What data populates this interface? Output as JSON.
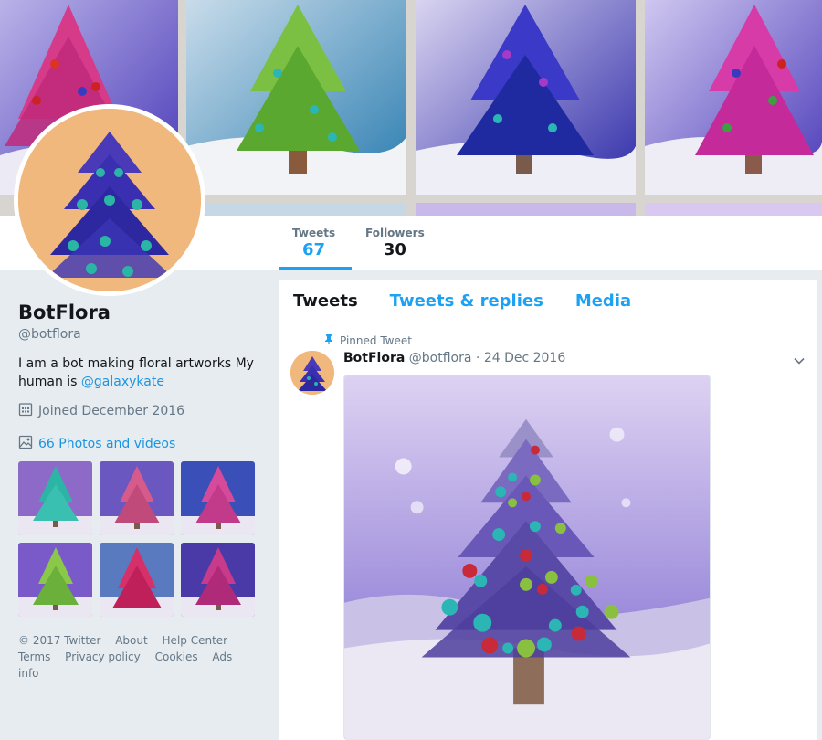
{
  "profile": {
    "name": "BotFlora",
    "handle": "@botflora",
    "bio_text": "I am a bot making floral artworks My human is ",
    "bio_link": "@galaxykate",
    "joined": "Joined December 2016",
    "photos_link": "66 Photos and videos"
  },
  "stats": [
    {
      "label": "Tweets",
      "value": "67"
    },
    {
      "label": "Followers",
      "value": "30"
    }
  ],
  "tabs": [
    "Tweets",
    "Tweets & replies",
    "Media"
  ],
  "tweet": {
    "pinned_label": "Pinned Tweet",
    "author": "BotFlora",
    "handle": "@botflora",
    "date": "24 Dec 2016",
    "separator": "·"
  },
  "footer": {
    "row1": [
      "© 2017 Twitter",
      "About",
      "Help Center"
    ],
    "row2": [
      "Terms",
      "Privacy policy",
      "Cookies",
      "Ads info"
    ]
  },
  "colors": {
    "accent": "#1da1f2",
    "link": "#1b95e0",
    "avatar_bg": "#f0b87c"
  },
  "icons": {
    "pin": "pin-icon",
    "calendar": "calendar-icon",
    "image": "image-icon",
    "caret": "chevron-down-icon"
  }
}
